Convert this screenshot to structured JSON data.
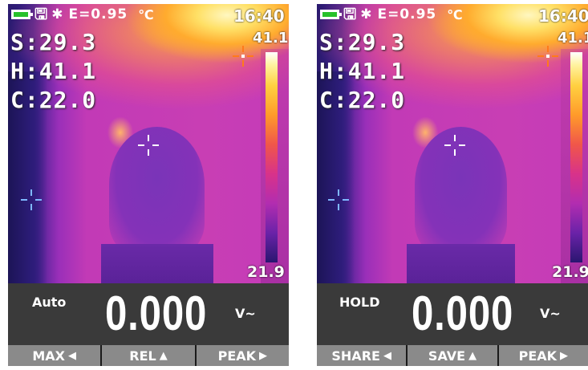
{
  "status": {
    "battery_icon": "battery-full-icon",
    "save_icon": "save-icon",
    "save_glyph": "💾",
    "bluetooth_icon": "bluetooth-icon",
    "bluetooth_glyph": "✱",
    "emissivity": "E=0.95",
    "unit": "℃",
    "time": "16:40"
  },
  "readings": {
    "spot": "S:29.3",
    "high": "H:41.1",
    "center": "C:22.0"
  },
  "scale": {
    "max": "41.1",
    "min": "21.9"
  },
  "colors": {
    "battery": "#27c12a",
    "meter_bg": "#3a3a3a",
    "button_bg": "#8a8a8a",
    "hot_cursor": "#ff7a1a",
    "cold_cursor": "#7fb8ff"
  },
  "screens": [
    {
      "mode_label": "Auto",
      "value": "0.000",
      "unit": "V~",
      "buttons": [
        {
          "label": "MAX",
          "glyph": "◀"
        },
        {
          "label": "REL",
          "glyph": "▲"
        },
        {
          "label": "PEAK",
          "glyph": "▶"
        }
      ]
    },
    {
      "mode_label": "HOLD",
      "value": "0.000",
      "unit": "V~",
      "buttons": [
        {
          "label": "SHARE",
          "glyph": "◀"
        },
        {
          "label": "SAVE",
          "glyph": "▲"
        },
        {
          "label": "PEAK",
          "glyph": "▶"
        }
      ]
    }
  ]
}
